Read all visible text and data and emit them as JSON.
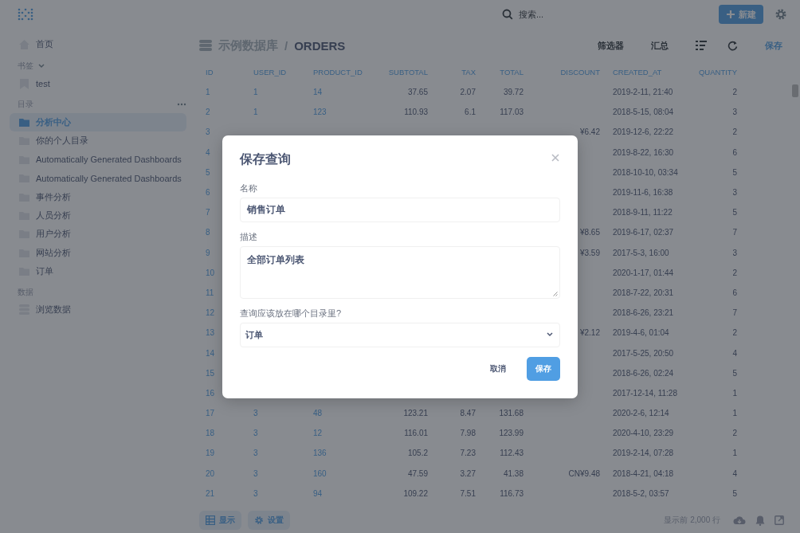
{
  "topbar": {
    "search_placeholder": "搜索...",
    "new_button": "新建"
  },
  "sidebar": {
    "home": {
      "label": "首页",
      "selected": false
    },
    "groups": [
      {
        "kind": "bookmarks",
        "title": "书签",
        "items": [
          {
            "label": "test",
            "selected": false
          }
        ]
      },
      {
        "kind": "collections",
        "title": "目录",
        "items": [
          {
            "label": "分析中心",
            "selected": true
          },
          {
            "label": "你的个人目录",
            "selected": false
          },
          {
            "label": "Automatically Generated Dashboards",
            "selected": false
          },
          {
            "label": "Automatically Generated Dashboards",
            "selected": false
          },
          {
            "label": "事件分析",
            "selected": false
          },
          {
            "label": "人员分析",
            "selected": false
          },
          {
            "label": "用户分析",
            "selected": false
          },
          {
            "label": "网站分析",
            "selected": false
          },
          {
            "label": "订单",
            "selected": false
          }
        ]
      },
      {
        "kind": "data",
        "title": "数据",
        "items": [
          {
            "label": "浏览数据",
            "selected": false
          }
        ]
      }
    ]
  },
  "header": {
    "database": "示例数据库",
    "separator": "/",
    "table": "ORDERS",
    "actions": [
      {
        "kind": "text",
        "label": "筛选器"
      },
      {
        "kind": "text",
        "label": "汇总"
      },
      {
        "kind": "list"
      },
      {
        "kind": "refresh"
      },
      {
        "kind": "link",
        "label": "保存"
      }
    ]
  },
  "table": {
    "columns": [
      {
        "label": "ID",
        "kind": "link"
      },
      {
        "label": "USER_ID",
        "kind": "link"
      },
      {
        "label": "PRODUCT_ID",
        "kind": "link"
      },
      {
        "label": "SUBTOTAL",
        "kind": "number"
      },
      {
        "label": "TAX",
        "kind": "number"
      },
      {
        "label": "TOTAL",
        "kind": "number"
      },
      {
        "label": "DISCOUNT",
        "kind": "number"
      },
      {
        "label": "CREATED_AT",
        "kind": "text"
      },
      {
        "label": "QUANTITY",
        "kind": "number"
      }
    ],
    "rows": [
      [
        "1",
        "1",
        "14",
        "37.65",
        "2.07",
        "39.72",
        null,
        "2019-2-11, 21:40",
        "2"
      ],
      [
        "2",
        "1",
        "123",
        "110.93",
        "6.1",
        "117.03",
        null,
        "2018-5-15, 08:04",
        "3"
      ],
      [
        "3",
        null,
        null,
        null,
        null,
        null,
        "¥6.42",
        "2019-12-6, 22:22",
        "2"
      ],
      [
        "4",
        null,
        null,
        null,
        null,
        null,
        null,
        "2019-8-22, 16:30",
        "6"
      ],
      [
        "5",
        null,
        null,
        null,
        null,
        null,
        null,
        "2018-10-10, 03:34",
        "5"
      ],
      [
        "6",
        null,
        null,
        null,
        null,
        null,
        null,
        "2019-11-6, 16:38",
        "3"
      ],
      [
        "7",
        null,
        null,
        null,
        null,
        null,
        null,
        "2018-9-11, 11:22",
        "5"
      ],
      [
        "8",
        null,
        null,
        null,
        null,
        null,
        "¥8.65",
        "2019-6-17, 02:37",
        "7"
      ],
      [
        "9",
        null,
        null,
        null,
        null,
        null,
        "¥3.59",
        "2017-5-3, 16:00",
        "3"
      ],
      [
        "10",
        null,
        null,
        null,
        null,
        null,
        null,
        "2020-1-17, 01:44",
        "2"
      ],
      [
        "11",
        null,
        null,
        null,
        null,
        null,
        null,
        "2018-7-22, 20:31",
        "6"
      ],
      [
        "12",
        null,
        null,
        null,
        null,
        null,
        null,
        "2018-6-26, 23:21",
        "7"
      ],
      [
        "13",
        null,
        null,
        null,
        null,
        null,
        "¥2.12",
        "2019-4-6, 01:04",
        "2"
      ],
      [
        "14",
        null,
        null,
        null,
        null,
        null,
        null,
        "2017-5-25, 20:50",
        "4"
      ],
      [
        "15",
        null,
        null,
        null,
        null,
        null,
        null,
        "2018-6-26, 02:24",
        "5"
      ],
      [
        "16",
        null,
        null,
        null,
        null,
        null,
        null,
        "2017-12-14, 11:28",
        "1"
      ],
      [
        "17",
        "3",
        "48",
        "123.21",
        "8.47",
        "131.68",
        null,
        "2020-2-6, 12:14",
        "1"
      ],
      [
        "18",
        "3",
        "12",
        "116.01",
        "7.98",
        "123.99",
        null,
        "2020-4-10, 23:29",
        "2"
      ],
      [
        "19",
        "3",
        "136",
        "105.2",
        "7.23",
        "112.43",
        null,
        "2019-2-14, 07:28",
        "1"
      ],
      [
        "20",
        "3",
        "160",
        "47.59",
        "3.27",
        "41.38",
        "CN¥9.48",
        "2018-4-21, 04:18",
        "4"
      ],
      [
        "21",
        "3",
        "94",
        "109.22",
        "7.51",
        "116.73",
        null,
        "2018-5-2, 03:57",
        "5"
      ]
    ]
  },
  "footer": {
    "buttons": [
      {
        "kind": "table",
        "label": "显示"
      },
      {
        "kind": "settings",
        "label": "设置"
      }
    ],
    "row_count": "显示前 2,000 行"
  },
  "modal": {
    "title": "保存查询",
    "fields": [
      {
        "kind": "input",
        "label": "名称",
        "value": "销售订单"
      },
      {
        "kind": "textarea",
        "label": "描述",
        "value": "全部订单列表"
      },
      {
        "kind": "select",
        "label": "查询应该放在哪个目录里?",
        "value": "订单"
      }
    ],
    "buttons": [
      {
        "kind": "secondary",
        "label": "取消"
      },
      {
        "kind": "primary",
        "label": "保存"
      }
    ]
  }
}
